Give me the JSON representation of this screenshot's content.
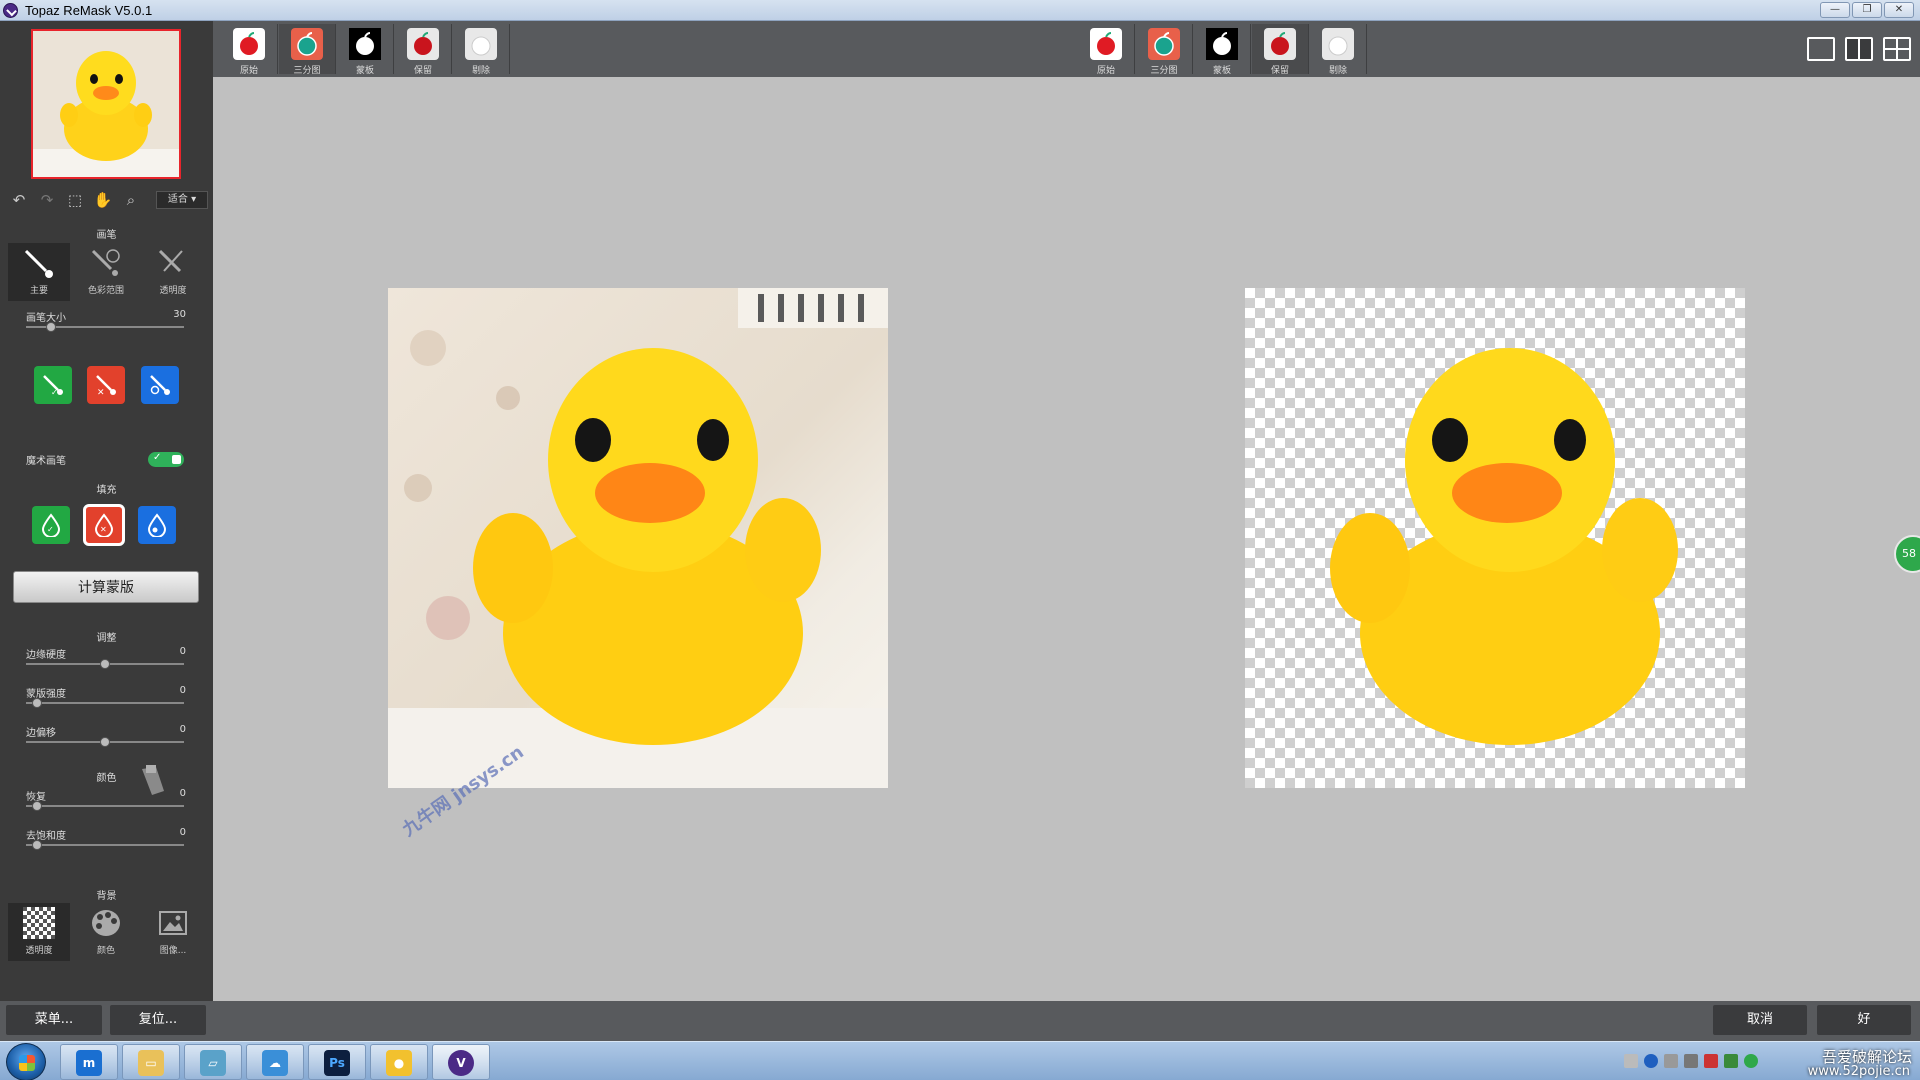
{
  "window": {
    "title": "Topaz ReMask V5.0.1",
    "controls": [
      "—",
      "❐",
      "✕"
    ]
  },
  "toolbar": {
    "left_views": [
      {
        "label": "原始",
        "icon": "apple-red-icon",
        "bg": "#ffffff"
      },
      {
        "label": "三分图",
        "icon": "apple-teal-icon",
        "bg": "#e8604a"
      },
      {
        "label": "蒙板",
        "icon": "apple-black-icon",
        "bg": "#ffffff"
      },
      {
        "label": "保留",
        "icon": "apple-red-icon",
        "bg": "#e8e8e8"
      },
      {
        "label": "剔除",
        "icon": "checker-icon",
        "bg": "#e8e8e8"
      }
    ],
    "right_views": [
      {
        "label": "原始",
        "icon": "apple-red-icon",
        "bg": "#ffffff"
      },
      {
        "label": "三分图",
        "icon": "apple-teal-icon",
        "bg": "#e8604a"
      },
      {
        "label": "蒙板",
        "icon": "apple-black-icon",
        "bg": "#ffffff"
      },
      {
        "label": "保留",
        "icon": "apple-red-icon",
        "bg": "#e8e8e8"
      },
      {
        "label": "剔除",
        "icon": "checker-icon",
        "bg": "#e8e8e8"
      }
    ],
    "active_left": "三分图",
    "active_right": "保留"
  },
  "nav": {
    "zoom": "适合 ▾"
  },
  "brush": {
    "section": "画笔",
    "tools": [
      "主要",
      "色彩范围",
      "透明度"
    ],
    "size_label": "画笔大小",
    "size_value": "30",
    "size_fraction": 0.15,
    "magic_label": "魔术画笔"
  },
  "fill": {
    "section": "填充"
  },
  "compute_button": "计算蒙版",
  "adjust": {
    "section": "调整",
    "sliders": [
      {
        "label": "边缘硬度",
        "value": "0",
        "fraction": 0.5
      },
      {
        "label": "蒙版强度",
        "value": "0",
        "fraction": 0.05
      },
      {
        "label": "边偏移",
        "value": "0",
        "fraction": 0.5
      }
    ],
    "color_section": "颜色",
    "color_sliders": [
      {
        "label": "恢复",
        "value": "0",
        "fraction": 0.05
      },
      {
        "label": "去饱和度",
        "value": "0",
        "fraction": 0.05
      }
    ]
  },
  "background": {
    "section": "背景",
    "tools": [
      "透明度",
      "颜色",
      "图像..."
    ]
  },
  "bottom": {
    "menu": "菜单...",
    "reset": "复位...",
    "cancel": "取消",
    "ok": "好"
  },
  "side_badge": "58",
  "watermark": "九牛网 jnsys.cn",
  "tray": {
    "brand": "吾爱破解论坛",
    "site": "www.52pojie.cn"
  },
  "colors": {
    "accent_green": "#22a843",
    "accent_red": "#e2412c",
    "accent_blue": "#1a6fe0",
    "thumb_border": "#e8242b"
  }
}
